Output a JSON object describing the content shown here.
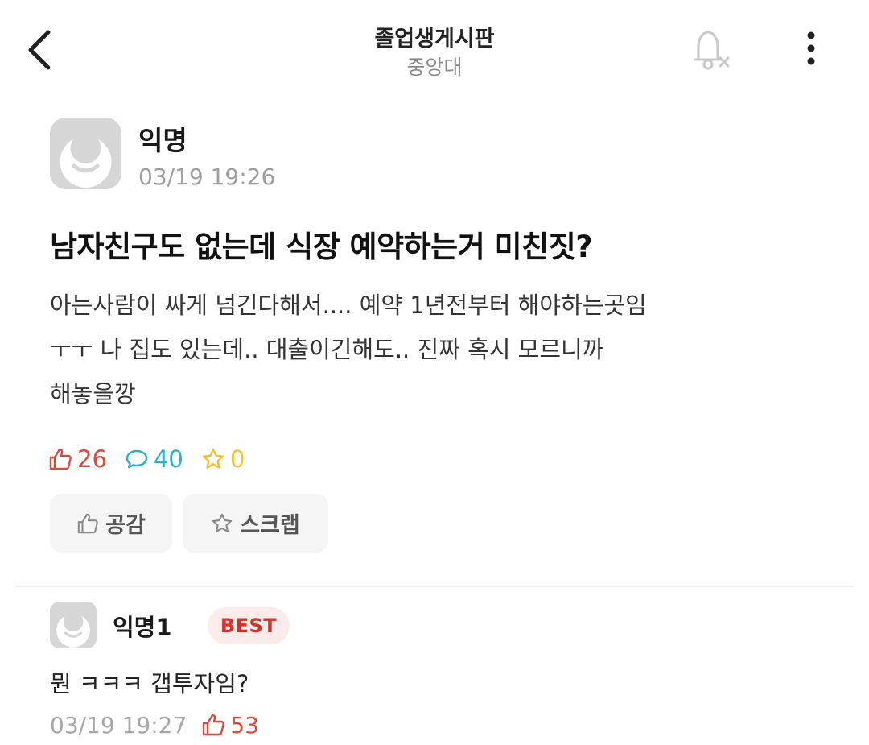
{
  "header": {
    "title": "졸업생게시판",
    "subtitle": "중앙대",
    "back_icon": "chevron-left-icon",
    "bell_icon": "bell-off-icon",
    "more_icon": "more-vertical-icon"
  },
  "post": {
    "author": "익명",
    "time": "03/19 19:26",
    "title": "남자친구도 없는데 식장 예약하는거 미친짓?",
    "body_lines": [
      "아는사람이 싸게 넘긴다해서.... 예약 1년전부터 해야하는곳임",
      "ㅜㅜ 나 집도 있는데.. 대출이긴해도.. 진짜 혹시 모르니까",
      "해놓을깡"
    ],
    "stats": {
      "likes": "26",
      "comments": "40",
      "scraps": "0"
    },
    "buttons": {
      "empathy": "공감",
      "scrap": "스크랩"
    }
  },
  "comment": {
    "author": "익명1",
    "badge": "BEST",
    "body": "뭔 ㅋㅋㅋ 갭투자임?",
    "time": "03/19 19:27",
    "likes": "53"
  },
  "colors": {
    "like": "#d94a3c",
    "comment": "#2ab0c2",
    "scrap": "#f2c12e",
    "best_text": "#d6302a",
    "best_bg": "#fbeceb"
  }
}
